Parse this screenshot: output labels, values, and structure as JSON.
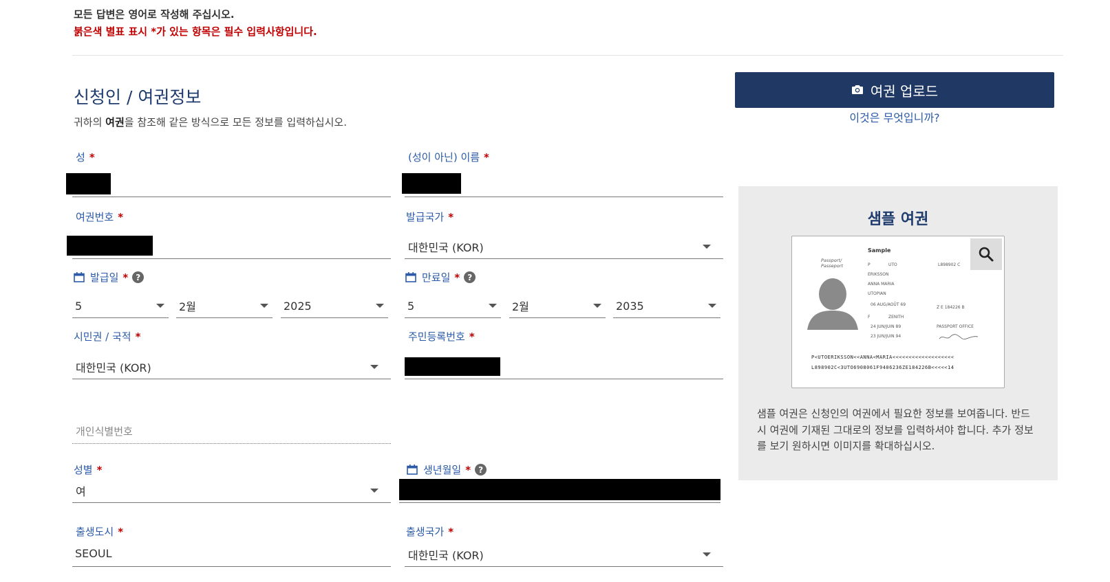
{
  "notice": {
    "line1": "모든 답변은 영어로 작성해 주십시오.",
    "line2": "붉은색 별표 표시 *가 있는 항목은 필수 입력사항입니다."
  },
  "section": {
    "title": "신청인 / 여권정보",
    "desc_pre": "귀하의 ",
    "desc_bold": "여권",
    "desc_post": "을 참조해 같은 방식으로 모든 정보를 입력하십시오."
  },
  "required_mark": "*",
  "help_glyph": "?",
  "fields": {
    "surname": {
      "label": "성"
    },
    "given_name": {
      "label": "(성이 아닌) 이름"
    },
    "passport_number": {
      "label": "여권번호"
    },
    "issuing_country": {
      "label": "발급국가",
      "value": "대한민국 (KOR)"
    },
    "issue_date": {
      "label": "발급일",
      "day": "5",
      "month": "2월",
      "year": "2025"
    },
    "expiry_date": {
      "label": "만료일",
      "day": "5",
      "month": "2월",
      "year": "2035"
    },
    "citizenship": {
      "label": "시민권 / 국적",
      "value": "대한민국 (KOR)"
    },
    "resident_number": {
      "label": "주민등록번호"
    },
    "personal_id": {
      "placeholder": "개인식별번호"
    },
    "sex": {
      "label": "성별",
      "value": "여"
    },
    "birth_date": {
      "label": "생년월일"
    },
    "birth_city": {
      "label": "출생도시",
      "value": "SEOUL"
    },
    "birth_country": {
      "label": "출생국가",
      "value": "대한민국 (KOR)"
    }
  },
  "sidebar": {
    "upload_button": "여권 업로드",
    "what_link": "이것은 무엇입니까?",
    "sample_title": "샘플 여권",
    "sample_desc": "샘플 여권은 신청인의 여권에서 필요한 정보를 보여줍니다. 반드시 여권에 기재된 그대로의 정보를 입력하셔야 합니다. 추가 정보를 보기 원하시면 이미지를 확대하십시오."
  },
  "sample_passport": {
    "heading": "Sample",
    "passport_label": "Passport/ Passeport",
    "type": "P",
    "country_code": "UTO",
    "number": "L898902 C",
    "surname": "ERIKSSON",
    "given_names": "ANNA MARIA",
    "nationality": "UTOPIAN",
    "birth_date": "06 AUG/AOÛT 69",
    "personal_no": "Z E 184226 B",
    "sex": "F",
    "birth_place": "ZENITH",
    "issue_date": "24 JUN/JUIN 89",
    "authority": "PASSPORT OFFICE",
    "expiry_date": "23 JUN/JUIN 94",
    "mrz1": "P<UTOERIKSSON<<ANNA<MARIA<<<<<<<<<<<<<<<<<<<",
    "mrz2": "L898902C<3UTO6908061F9406236ZE184226B<<<<<14"
  },
  "icons": {
    "calendar": "calendar-icon",
    "camera": "camera-icon",
    "search": "search-icon",
    "dropdown": "chevron-down-icon"
  },
  "colors": {
    "accent": "#1f3864",
    "label": "#2a5aa8",
    "required": "#c00000",
    "sample_bg": "#ebebeb"
  }
}
